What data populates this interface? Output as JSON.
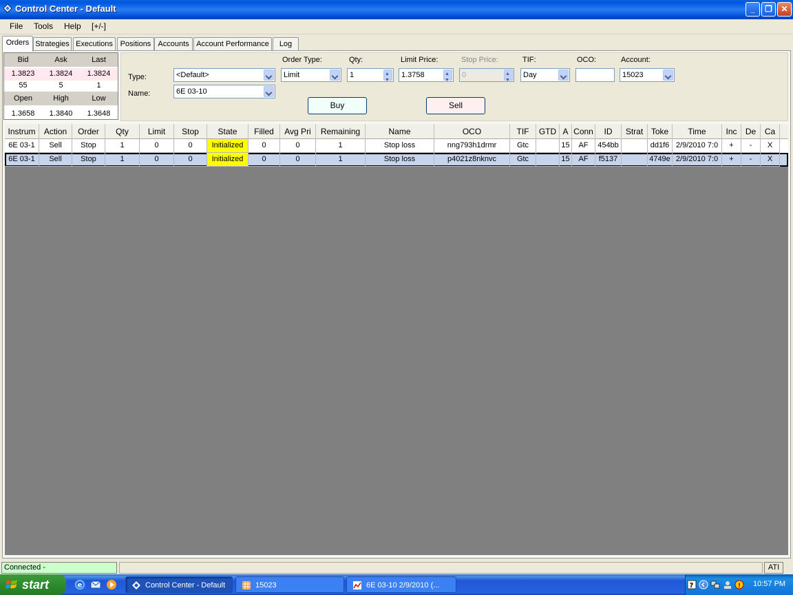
{
  "window": {
    "title": "Control Center - Default"
  },
  "menu": [
    "File",
    "Tools",
    "Help",
    "[+/-]"
  ],
  "tabs": [
    "Orders",
    "Strategies",
    "Executions",
    "Positions",
    "Accounts",
    "Account Performance",
    "Log"
  ],
  "quote": {
    "headers1": [
      "Bid",
      "Ask",
      "Last"
    ],
    "values1": [
      "1.3823",
      "1.3824",
      "1.3824"
    ],
    "sizes": [
      "55",
      "5",
      "1"
    ],
    "headers2": [
      "Open",
      "High",
      "Low"
    ],
    "values2": [
      "1.3658",
      "1.3840",
      "1.3648"
    ]
  },
  "order_form": {
    "type_label": "Type:",
    "type_value": "<Default>",
    "name_label": "Name:",
    "name_value": "6E 03-10",
    "order_type_label": "Order Type:",
    "order_type_value": "Limit",
    "qty_label": "Qty:",
    "qty_value": "1",
    "limit_price_label": "Limit Price:",
    "limit_price_value": "1.3758",
    "stop_price_label": "Stop Price:",
    "stop_price_value": "0",
    "tif_label": "TIF:",
    "tif_value": "Day",
    "oco_label": "OCO:",
    "oco_value": "",
    "account_label": "Account:",
    "account_value": "15023",
    "buy_label": "Buy",
    "sell_label": "Sell",
    "buy_color": "#f0fff8",
    "sell_color": "#fff0f0"
  },
  "grid": {
    "columns": [
      "Instrum",
      "Action",
      "Order",
      "Qty",
      "Limit",
      "Stop",
      "State",
      "Filled",
      "Avg Pri",
      "Remaining",
      "Name",
      "OCO",
      "TIF",
      "GTD",
      "A",
      "Conn",
      "ID",
      "Strat",
      "Toke",
      "Time",
      "Inc",
      "De",
      "Ca"
    ],
    "rows": [
      [
        "6E 03-1",
        "Sell",
        "Stop",
        "1",
        "0",
        "0",
        "Initialized",
        "0",
        "0",
        "1",
        "Stop loss",
        "nng793h1drmr",
        "Gtc",
        "",
        "15",
        "AF",
        "454bb",
        "",
        "dd1f6",
        "2/9/2010 7:0",
        "+",
        "-",
        "X"
      ],
      [
        "6E 03-1",
        "Sell",
        "Stop",
        "1",
        "0",
        "0",
        "Initialized",
        "0",
        "0",
        "1",
        "Stop loss",
        "p4021z8nknvc",
        "Gtc",
        "",
        "15",
        "AF",
        "f5137",
        "",
        "4749e",
        "2/9/2010 7:0",
        "+",
        "-",
        "X"
      ]
    ],
    "state_color": "#ffff00"
  },
  "status": {
    "connection": "Connected - TradingTechnologies",
    "right": "ATI"
  },
  "taskbar": {
    "start": "start",
    "tasks": [
      "Control Center - Default",
      "15023",
      "6E 03-10  2/9/2010 (..."
    ],
    "clock": "10:57 PM"
  }
}
